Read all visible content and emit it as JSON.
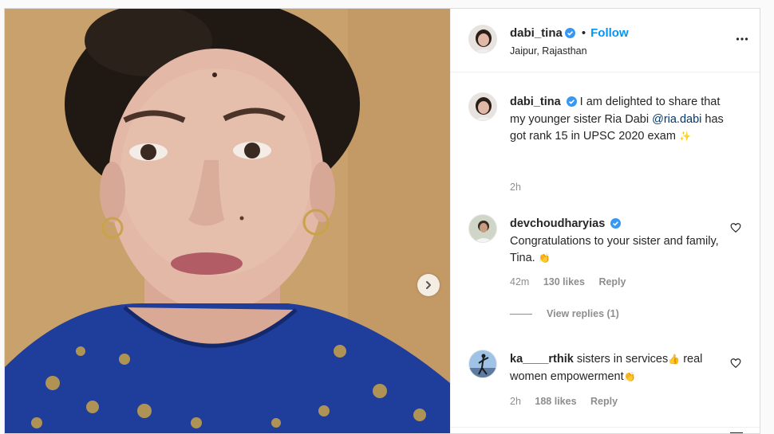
{
  "post": {
    "author": {
      "username": "dabi_tina",
      "location": "Jaipur, Rajasthan",
      "follow_label": "Follow",
      "separator": "•"
    },
    "caption": {
      "username": "dabi_tina",
      "text_before": "I am delighted to share that my younger sister Ria Dabi ",
      "mention": "@ria.dabi",
      "text_after": " has got rank 15 in UPSC 2020 exam ",
      "emoji": "✨",
      "time": "2h"
    },
    "comments": [
      {
        "username": "devchoudharyias",
        "text": "Congratulations to your sister and family, Tina. ",
        "emoji": "👏",
        "time": "42m",
        "likes": "130 likes",
        "reply_label": "Reply",
        "view_replies": "View replies (1)"
      },
      {
        "username": "ka____rthik",
        "text_before": "sisters in services",
        "emoji1": "👍",
        "text_after": " real women empowerment",
        "emoji2": "👏",
        "time": "2h",
        "likes": "188 likes",
        "reply_label": "Reply"
      }
    ]
  },
  "colors": {
    "accent": "#0095f6",
    "muted": "#8e8e8e",
    "verified": "#3897f0"
  },
  "icons": [
    "chevron-right-icon",
    "verified-badge-icon",
    "more-options-icon",
    "heart-icon",
    "comment-icon",
    "share-icon",
    "bookmark-icon"
  ]
}
